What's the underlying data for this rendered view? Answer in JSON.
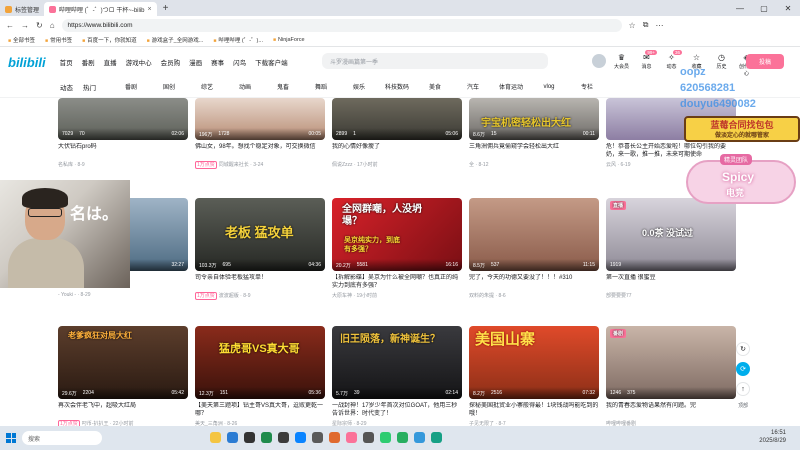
{
  "browser": {
    "tabs": [
      {
        "label": "标签管理",
        "active": false
      },
      {
        "label": "哔哩哔哩 (゜-゜)つロ 干杯~-bilib",
        "active": true
      }
    ],
    "new_tab": "+",
    "url": "https://www.bilibili.com",
    "bookmarks": [
      "全部书签",
      "常用书签",
      "百度一下，你就知道",
      "游戏盒子_全网游戏...",
      "哔哩哔哩 (゜-゜)...",
      "NinjaForce"
    ]
  },
  "header": {
    "logo": "bilibili",
    "nav": [
      "首页",
      "番剧",
      "直播",
      "游戏中心",
      "会员购",
      "漫画",
      "赛事",
      "闪鸟",
      "下载客户端"
    ],
    "search_placeholder": "斗罗漫画篇第一季",
    "icons": [
      {
        "label": "大会员",
        "icon": "crown-icon",
        "badge": ""
      },
      {
        "label": "消息",
        "icon": "message-icon",
        "badge": "99+"
      },
      {
        "label": "动态",
        "icon": "dynamic-icon",
        "badge": "36"
      },
      {
        "label": "收藏",
        "icon": "star-icon",
        "badge": ""
      },
      {
        "label": "历史",
        "icon": "clock-icon",
        "badge": ""
      },
      {
        "label": "创作中心",
        "icon": "bulb-icon",
        "badge": ""
      }
    ],
    "upload": "投稿"
  },
  "channels": {
    "main": [
      "动态",
      "热门"
    ],
    "items": [
      "番剧",
      "国创",
      "综艺",
      "动画",
      "鬼畜",
      "舞蹈",
      "娱乐",
      "科技数码",
      "美食",
      "汽车",
      "体育运动",
      "vlog",
      "专栏"
    ]
  },
  "videos": [
    {
      "views": "7029",
      "comments": "70",
      "duration": "02:06",
      "title": "大伏钻石pro码",
      "author": "名私库",
      "date": "8-9",
      "tag": ""
    },
    {
      "views": "196万",
      "comments": "1728",
      "duration": "00:05",
      "title": "佛山女，98年。想找个稳定对象，可交换微信",
      "author": "同城醒来社长",
      "date": "3-24",
      "tag": "1万点赞"
    },
    {
      "views": "2899",
      "comments": "1",
      "duration": "05:06",
      "title": "我的心情好像瘦了",
      "author": "佩说Zzzz",
      "date": "17小时前",
      "tag": ""
    },
    {
      "views": "8.6万",
      "comments": "15",
      "duration": "00:11",
      "title": "三角洲佣兵竟偷窥学会轻松出大红",
      "author": "全",
      "date": "8-12",
      "tag": ""
    },
    {
      "views": "",
      "comments": "",
      "duration": "",
      "title": "危！恭喜长公主开始恋爱啦！哪位勾引我的要奶，来一歌，推一推，未来可期使命",
      "author": "云风",
      "date": "6-19",
      "tag": ""
    },
    {
      "views": "",
      "comments": "",
      "duration": "32:27",
      "title": "多Day5你的名",
      "author": "- Youki -",
      "date": "8-29",
      "tag": ""
    },
    {
      "views": "103.3万",
      "comments": "695",
      "duration": "04:36",
      "title": "司令亲自体验老板猛攻单！",
      "author": "波波超版",
      "date": "8-9",
      "tag": "1万点赞"
    },
    {
      "views": "20.2万",
      "comments": "5581",
      "duration": "16:16",
      "title": "【拆解影碟】吴京为什么被全网嘲？也真正的纯实力到底有多强？",
      "author": "大原车神",
      "date": "19小时前",
      "tag": ""
    },
    {
      "views": "8.5万",
      "comments": "537",
      "duration": "11:15",
      "title": "完了，今天的功德又要没了！！！#310",
      "author": "双料的朱提",
      "date": "8-6",
      "tag": ""
    },
    {
      "views": "1919",
      "comments": "",
      "duration": "",
      "title": "第一次直播 很蜜豆",
      "author": "部要要要77",
      "date": "",
      "tag": "直播"
    },
    {
      "views": "29.6万",
      "comments": "2204",
      "duration": "05:42",
      "title": "再次会伴老飞中，超吸大红局",
      "author": "叼币-扒扒王",
      "date": "22小时前",
      "tag": "1万点赞"
    },
    {
      "views": "12.3万",
      "comments": "151",
      "duration": "05:36",
      "title": "【美天第三题项】钻主哥VS真大哥，逗败更乾一哪？",
      "author": "美天_三角洲",
      "date": "8-26",
      "tag": ""
    },
    {
      "views": "5.7万",
      "comments": "39",
      "duration": "02:14",
      "title": "一战封神！17岁少年首次对位GOAT，他用三秒告诉世界：时代变了！",
      "author": "星际宗师",
      "date": "8-29",
      "tag": ""
    },
    {
      "views": "8.2万",
      "comments": "2516",
      "duration": "07:32",
      "title": "探秘美国批贸业小寨般得最！1块钱战吗能吃到的哦！",
      "author": "子见无限了",
      "date": "8-7",
      "tag": ""
    },
    {
      "views": "1246",
      "comments": "375",
      "duration": "",
      "title": "我的青春恋爱物语果然有问题。完",
      "author": "哔哩哔哩番剧",
      "date": "",
      "tag": "番剧"
    }
  ],
  "thumb_texts": {
    "t4": "宇宝机密轻松出大红",
    "t6": "老板 猛攻单",
    "t7": "全网群嘲，人没坍塌？",
    "t7b": "吴京纯实力，到底有多强？",
    "t10": "0.0茶 没试过",
    "t11": "老爹疯狂对局大红",
    "t12": "猛虎哥VS真大哥",
    "t13": "旧王陨落，新神诞生？",
    "t14": "美国山寨",
    "t5cam": "名は。"
  },
  "overlays": {
    "ids": [
      "oopz",
      "620568281",
      "douyu6490082"
    ],
    "banner_line1": "蓝莓合同找包包",
    "banner_line2": "做淡定心的就哪管家",
    "spicy_top": "精灵团队",
    "spicy_main": "Spicy",
    "spicy_sub": "电竞"
  },
  "side_float": [
    "↻",
    "⟳",
    "↑"
  ],
  "side_float_label": "顶部",
  "taskbar": {
    "search": "搜索",
    "time": "16:51",
    "date": "2025/8/29"
  }
}
